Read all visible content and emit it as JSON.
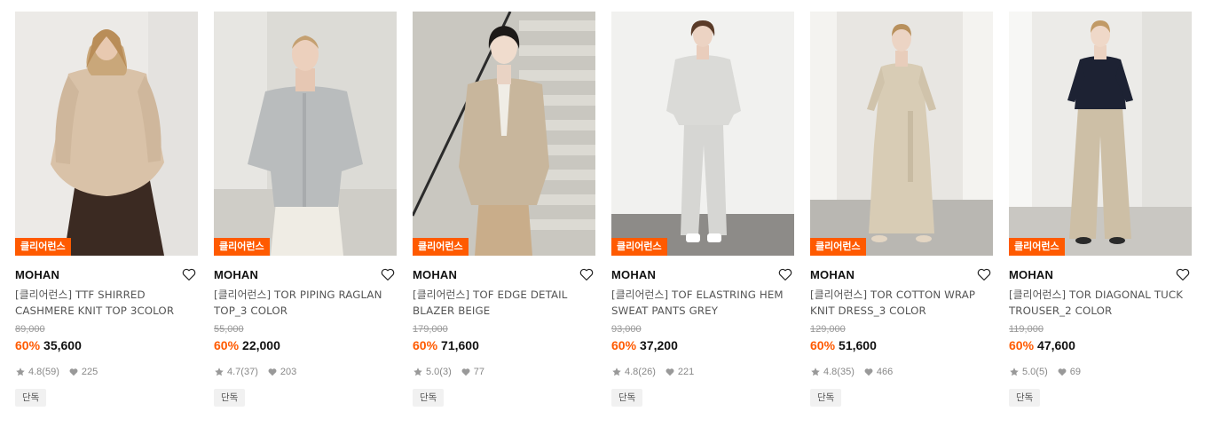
{
  "products": [
    {
      "badge": "클리어런스",
      "brand": "MOHAN",
      "name": "[클리어런스] TTF SHIRRED CASHMERE KNIT TOP 3COLOR",
      "original_price": "89,000",
      "discount": "60%",
      "price": "35,600",
      "rating": "4.8",
      "review_count": "(59)",
      "likes": "225",
      "tag": "단독",
      "image": "woman in beige shirred cashmere knit top with brown skirt"
    },
    {
      "badge": "클리어런스",
      "brand": "MOHAN",
      "name": "[클리어런스] TOR PIPING RAGLAN TOP_3 COLOR",
      "original_price": "55,000",
      "discount": "60%",
      "price": "22,000",
      "rating": "4.7",
      "review_count": "(37)",
      "likes": "203",
      "tag": "단독",
      "image": "woman in grey raglan top and white trousers"
    },
    {
      "badge": "클리어런스",
      "brand": "MOHAN",
      "name": "[클리어런스] TOF EDGE DETAIL BLAZER BEIGE",
      "original_price": "179,000",
      "discount": "60%",
      "price": "71,600",
      "rating": "5.0",
      "review_count": "(3)",
      "likes": "77",
      "tag": "단독",
      "image": "woman in beige blazer on stairs"
    },
    {
      "badge": "클리어런스",
      "brand": "MOHAN",
      "name": "[클리어런스] TOF ELASTRING HEM SWEAT PANTS GREY",
      "original_price": "93,000",
      "discount": "60%",
      "price": "37,200",
      "rating": "4.8",
      "review_count": "(26)",
      "likes": "221",
      "tag": "단독",
      "image": "woman in grey sweatshirt and sweat pants"
    },
    {
      "badge": "클리어런스",
      "brand": "MOHAN",
      "name": "[클리어런스] TOR COTTON WRAP KNIT DRESS_3 COLOR",
      "original_price": "129,000",
      "discount": "60%",
      "price": "51,600",
      "rating": "4.8",
      "review_count": "(35)",
      "likes": "466",
      "tag": "단독",
      "image": "woman in beige wrap knit dress"
    },
    {
      "badge": "클리어런스",
      "brand": "MOHAN",
      "name": "[클리어런스] TOR DIAGONAL TUCK TROUSER_2 COLOR",
      "original_price": "119,000",
      "discount": "60%",
      "price": "47,600",
      "rating": "5.0",
      "review_count": "(5)",
      "likes": "69",
      "tag": "단독",
      "image": "woman in navy cardigan and beige wide trousers"
    }
  ],
  "colors": {
    "badge": "#ff5a00",
    "discount": "#ff5a00",
    "text_primary": "#111111",
    "text_secondary": "#555555",
    "muted": "#999999"
  },
  "icons": {
    "wishlist": "heart-outline-icon",
    "rating": "star-icon",
    "likes": "heart-filled-icon"
  }
}
